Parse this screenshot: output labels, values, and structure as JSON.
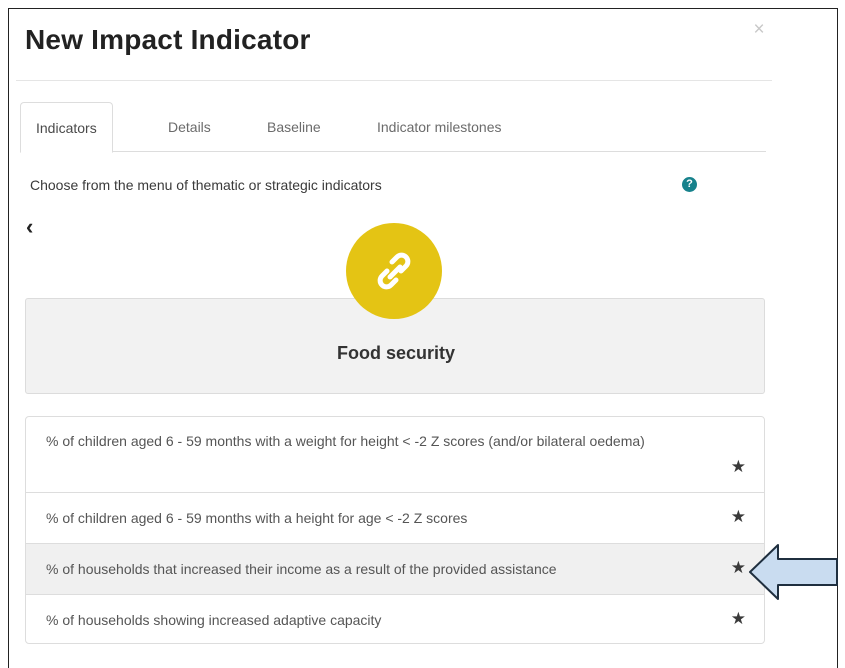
{
  "modal": {
    "title": "New Impact Indicator",
    "close_glyph": "×"
  },
  "tabs": [
    {
      "label": "Indicators",
      "active": true
    },
    {
      "label": "Details",
      "active": false
    },
    {
      "label": "Baseline",
      "active": false
    },
    {
      "label": "Indicator milestones",
      "active": false
    }
  ],
  "instructions": "Choose from the menu of thematic or strategic indicators",
  "icons": {
    "help": "question-circle-icon",
    "help_glyph": "?",
    "back": "chevron-left-icon",
    "back_glyph": "‹",
    "category": "link-icon",
    "star": "star-icon",
    "star_glyph": "★",
    "pointer": "arrow-left-icon"
  },
  "category": {
    "label": "Food security",
    "color": "#e4c414"
  },
  "indicators": [
    {
      "text": "% of children aged 6 - 59 months with a weight for height < -2 Z scores (and/or bilateral oedema)",
      "highlighted": false
    },
    {
      "text": "% of children aged 6 - 59 months with a height for age < -2 Z scores",
      "highlighted": false
    },
    {
      "text": "% of households that increased their income as a result of the provided assistance",
      "highlighted": true
    },
    {
      "text": "% of households showing increased adaptive capacity",
      "highlighted": false
    }
  ],
  "colors": {
    "accent_teal": "#17828c",
    "highlight_row": "#f0f0f0",
    "arrow_fill": "#c9dcf0",
    "arrow_stroke": "#1f2f3f"
  }
}
